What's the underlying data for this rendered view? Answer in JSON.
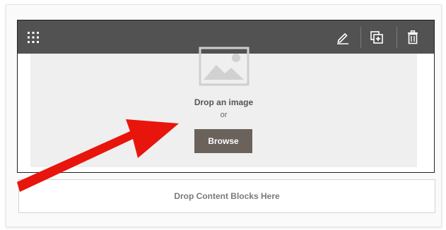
{
  "image_block": {
    "drop_label": "Drop an image",
    "or_label": "or",
    "browse_label": "Browse"
  },
  "dropzone": {
    "label": "Drop Content Blocks Here"
  },
  "toolbar": {
    "icons": [
      "drag-handle-icon",
      "pencil-icon",
      "duplicate-icon",
      "trash-icon"
    ]
  },
  "colors": {
    "toolbar_bg": "#525252",
    "browse_bg": "#6b625c",
    "arrow": "#e8150c"
  }
}
